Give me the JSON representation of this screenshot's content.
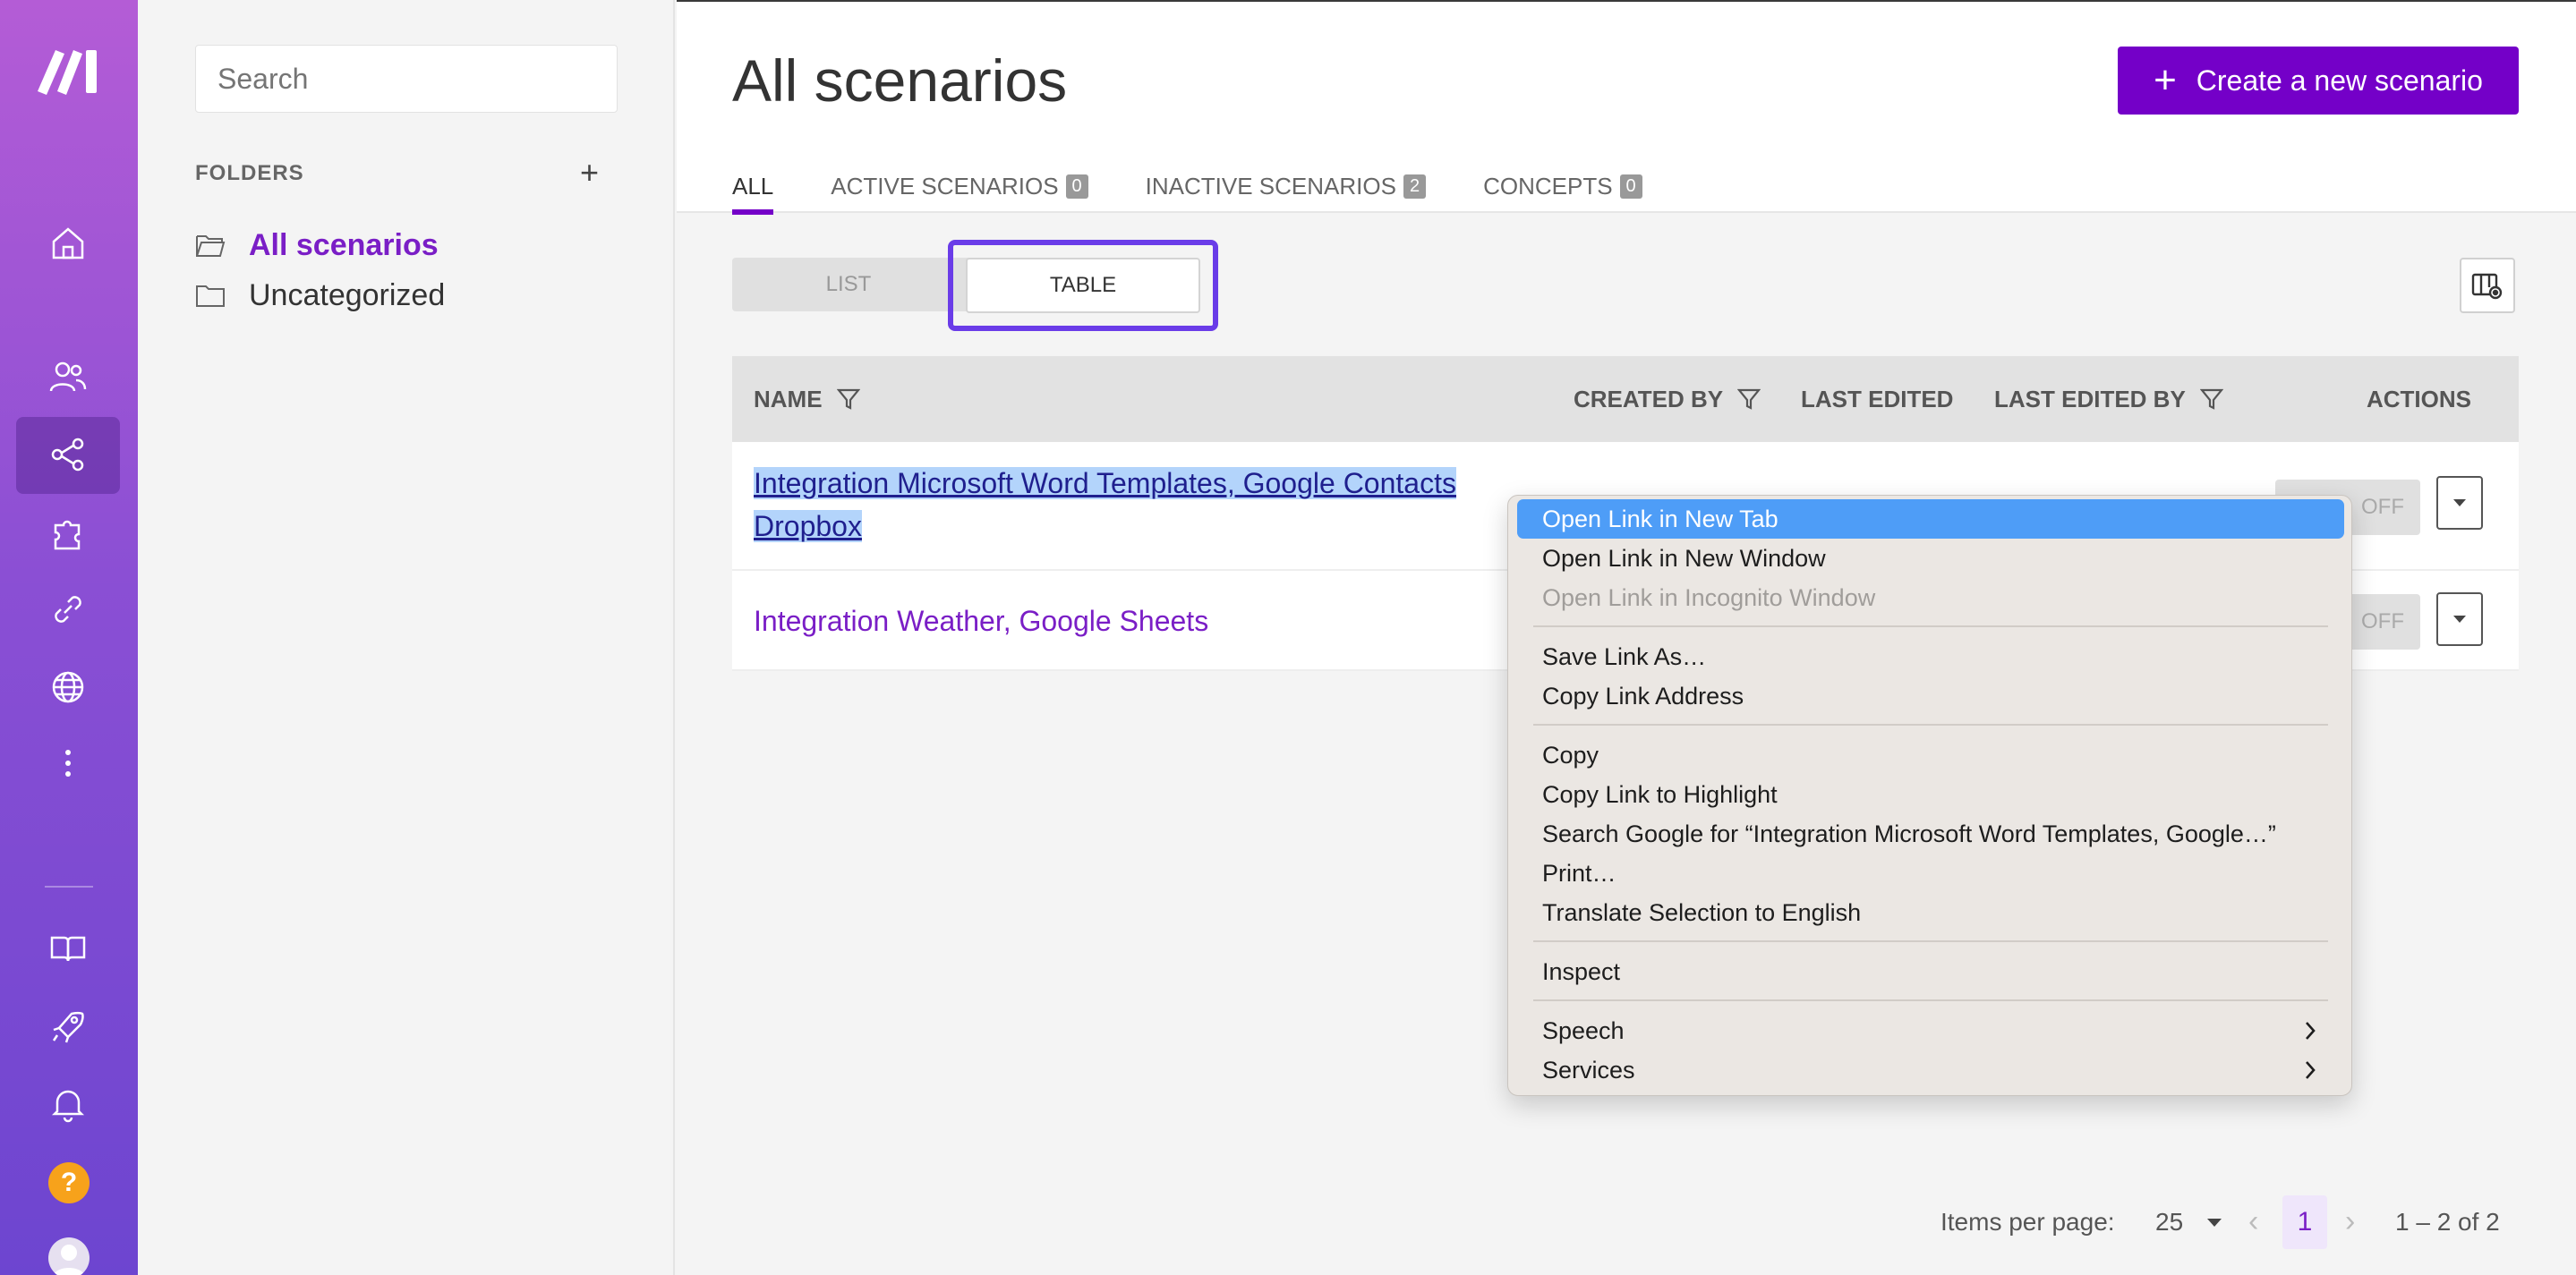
{
  "sidebar": {
    "icons": [
      "home-icon",
      "team-icon",
      "scenarios-icon",
      "templates-icon",
      "connections-icon",
      "webhooks-icon",
      "more-icon",
      "docs-icon",
      "whats-new-icon",
      "notifications-icon",
      "help-icon",
      "user-avatar"
    ]
  },
  "folders": {
    "search_placeholder": "Search",
    "header": "FOLDERS",
    "add": "+",
    "items": [
      {
        "label": "All scenarios",
        "active": true
      },
      {
        "label": "Uncategorized",
        "active": false
      }
    ]
  },
  "main": {
    "title": "All scenarios",
    "create_button": "Create a new scenario",
    "tabs": [
      {
        "label": "ALL",
        "count": null,
        "active": true
      },
      {
        "label": "ACTIVE SCENARIOS",
        "count": "0"
      },
      {
        "label": "INACTIVE SCENARIOS",
        "count": "2"
      },
      {
        "label": "CONCEPTS",
        "count": "0"
      }
    ],
    "view_toggle": {
      "list": "LIST",
      "table": "TABLE",
      "selected": "TABLE"
    },
    "table": {
      "columns": [
        "NAME",
        "CREATED BY",
        "LAST EDITED",
        "LAST EDITED BY",
        "ACTIONS"
      ],
      "rows": [
        {
          "name_line1": "Integration Microsoft Word Templates, Google Contacts",
          "name_line2": "Dropbox",
          "status": "OFF"
        },
        {
          "name_line1": "Integration Weather, Google Sheets",
          "status": "OFF"
        }
      ]
    },
    "pager": {
      "items_per_page_label": "Items per page:",
      "items_per_page": "25",
      "page": "1",
      "range": "1 – 2 of 2"
    }
  },
  "context_menu": {
    "items": [
      "Open Link in New Tab",
      "Open Link in New Window",
      "Open Link in Incognito Window",
      "Save Link As…",
      "Copy Link Address",
      "Copy",
      "Copy Link to Highlight",
      "Search Google for “Integration Microsoft Word Templates, Google…”",
      "Print…",
      "Translate Selection to English",
      "Inspect",
      "Speech",
      "Services"
    ],
    "highlighted": "Open Link in New Tab",
    "disabled": "Open Link in Incognito Window"
  },
  "colors": {
    "accent": "#7400c8",
    "highlight_frame": "#6a3ce8",
    "menu_highlight": "#4e9df7"
  }
}
